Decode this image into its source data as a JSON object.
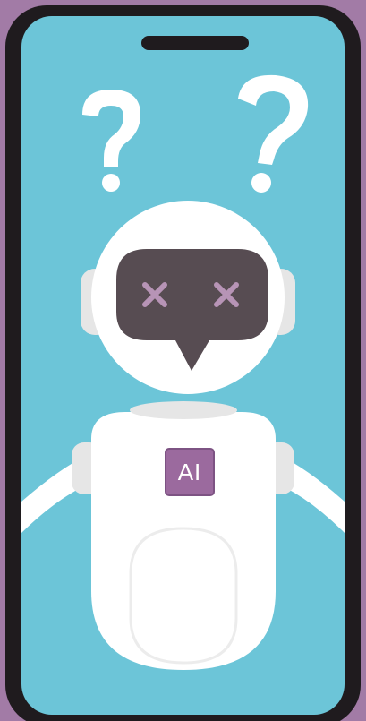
{
  "colors": {
    "background_frame": "#a27ba6",
    "phone_body": "#1f1b1e",
    "screen": "#6cc5d8",
    "robot_white": "#ffffff",
    "robot_shadow": "#e6e6e6",
    "visor": "#574c52",
    "eye_cross": "#b794b6",
    "badge": "#9b6a9e"
  },
  "icons": {
    "question_marks": "question-mark-icon",
    "eyes": "x-eye-icon"
  },
  "robot": {
    "badge_label": "AI"
  }
}
